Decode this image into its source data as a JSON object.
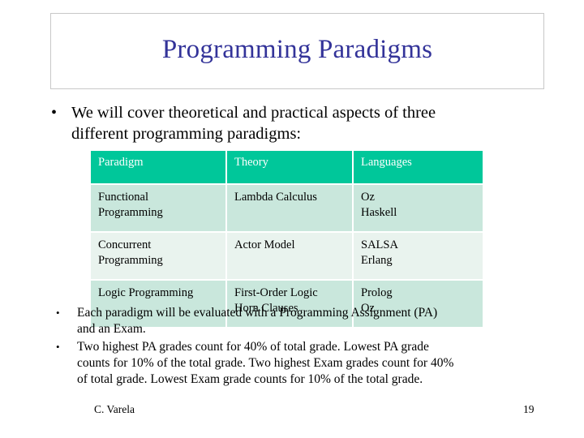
{
  "slide": {
    "title": "Programming Paradigms",
    "title_color": "#333399",
    "background": "#ffffff"
  },
  "main_bullet": {
    "marker": "•",
    "lines": [
      "We will cover theoretical and practical aspects of three",
      "different programming paradigms:"
    ]
  },
  "table": {
    "header_background": "#00c79a",
    "header_text_color": "#ffffff",
    "row_shade_a": "#c9e7dc",
    "row_shade_b": "#e9f3ee",
    "columns": [
      "Paradigm",
      "Theory",
      "Languages"
    ],
    "rows": [
      {
        "paradigm": [
          "Functional",
          "Programming"
        ],
        "theory": [
          "Lambda Calculus"
        ],
        "languages": [
          "Oz",
          "Haskell"
        ]
      },
      {
        "paradigm": [
          "Concurrent",
          "Programming"
        ],
        "theory": [
          "Actor Model"
        ],
        "languages": [
          "SALSA",
          "Erlang"
        ]
      },
      {
        "paradigm": [
          "Logic Programming"
        ],
        "theory": [
          "First-Order Logic",
          "Horn Clauses"
        ],
        "languages": [
          "Prolog",
          "Oz"
        ]
      }
    ]
  },
  "sub_bullets": {
    "marker": "•",
    "items": [
      {
        "lines": [
          "Each paradigm will be evaluated with a Programming Assignment (PA)",
          "and an Exam."
        ]
      },
      {
        "lines": [
          "Two highest PA grades count for 40% of total grade. Lowest PA grade",
          "counts for 10% of the total grade. Two highest Exam grades count for 40%",
          "of total grade. Lowest Exam grade counts for 10% of the total grade."
        ]
      }
    ]
  },
  "footer": {
    "author": "C. Varela",
    "slide_number": "19"
  }
}
